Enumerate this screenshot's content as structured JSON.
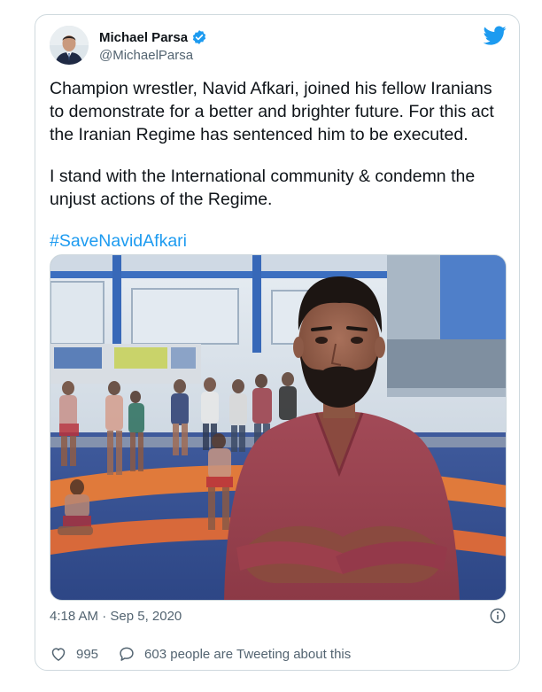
{
  "author": {
    "name": "Michael Parsa",
    "handle": "@MichaelParsa",
    "verified": true
  },
  "tweet": {
    "paragraphs": [
      "Champion wrestler, Navid Afkari, joined his fellow Iranians to demonstrate for a better and brighter future. For this act the Iranian Regime has sentenced him to be executed.",
      "I stand with the International community & condemn the unjust actions of the Regime."
    ],
    "hashtag": "#SaveNavidAfkari"
  },
  "meta": {
    "timestamp": "4:18 AM · Sep 5, 2020"
  },
  "actions": {
    "like_count": "995",
    "conversation_label": "603 people are Tweeting about this"
  },
  "icons": {
    "brand": "twitter-bird-icon",
    "verified": "verified-badge-icon",
    "info": "info-icon",
    "like": "heart-icon",
    "reply": "speech-bubble-icon"
  },
  "colors": {
    "accent": "#1d9bf0",
    "text": "#0f1419",
    "muted": "#536471",
    "border": "#cfd9de"
  }
}
